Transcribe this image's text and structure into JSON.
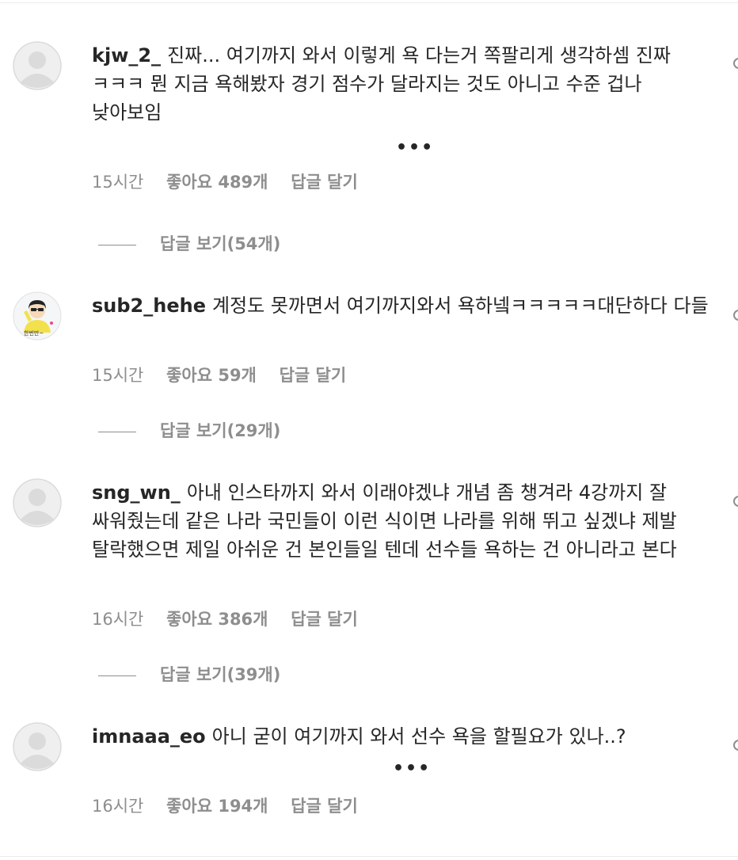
{
  "comments": [
    {
      "username": "kjw_2_",
      "text": "진짜... 여기까지 와서 이렇게 욕 다는거 쪽팔리게 생각하셈 진짜 ㅋㅋㅋ 뭔 지금 욕해봤자 경기 점수가 달라지는 것도 아니고 수준 겁나 낮아보임",
      "time": "15시간",
      "likes": "좋아요 489개",
      "reply": "답글 달기",
      "view_replies": "답글 보기(54개)",
      "avatar": "default-avatar"
    },
    {
      "username": "sub2_hehe",
      "text": "계정도 못까면서 여기까지와서 욕하넼ㅋㅋㅋㅋㅋ대단하다 다들",
      "time": "15시간",
      "likes": "좋아요 59개",
      "reply": "답글 달기",
      "view_replies": "답글 보기(29개)",
      "avatar": "cartoon-avatar",
      "avatar_caption": "한번만~"
    },
    {
      "username": "sng_wn_",
      "text": "아내 인스타까지 와서 이래야겠냐 개념 좀 챙겨라 4강까지 잘 싸워줬는데 같은 나라 국민들이 이런 식이면 나라를 위해 뛰고 싶겠냐 제발 탈락했으면 제일 아쉬운 건 본인들일 텐데 선수들 욕하는 건 아니라고 본다",
      "time": "16시간",
      "likes": "좋아요 386개",
      "reply": "답글 달기",
      "view_replies": "답글 보기(39개)",
      "avatar": "default-avatar"
    },
    {
      "username": "imnaaa_eo",
      "text": "아니 굳이 여기까지 와서 선수 욕을 할필요가 있나..?",
      "time": "16시간",
      "likes": "좋아요 194개",
      "reply": "답글 달기",
      "avatar": "default-avatar"
    }
  ],
  "more_label": "•••",
  "colors": {
    "text": "#262626",
    "secondary": "#8e8e8e",
    "avatar_bg": "#dbdbdb"
  }
}
